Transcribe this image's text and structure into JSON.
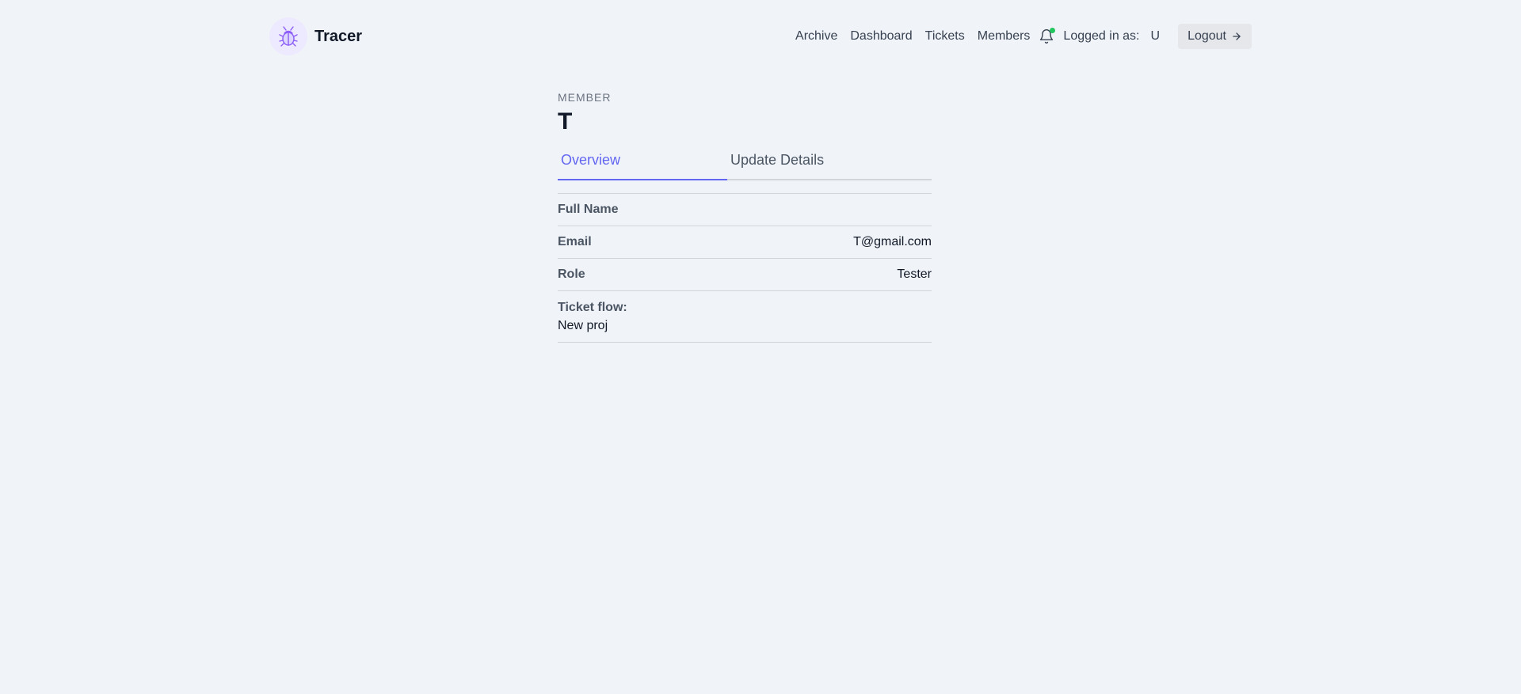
{
  "app": {
    "brand_name": "Tracer",
    "logo_icon": "bug-icon",
    "accent_color": "#6366f1"
  },
  "nav": {
    "links": [
      "Archive",
      "Dashboard",
      "Tickets",
      "Members"
    ],
    "notification_icon": "bell-icon",
    "notification_dot_color": "#22c55e",
    "logged_in_label": "Logged in as:",
    "logged_in_user": "U",
    "logout_label": "Logout",
    "logout_icon": "arrow-right-icon"
  },
  "member": {
    "eyebrow": "MEMBER",
    "name": "T"
  },
  "tabs": [
    {
      "label": "Overview",
      "active": true
    },
    {
      "label": "Update Details",
      "active": false
    }
  ],
  "details": {
    "full_name": {
      "label": "Full Name",
      "value": ""
    },
    "email": {
      "label": "Email",
      "value": "T@gmail.com"
    },
    "role": {
      "label": "Role",
      "value": "Tester"
    },
    "ticket_flow": {
      "label": "Ticket flow:",
      "value": "New proj"
    }
  }
}
